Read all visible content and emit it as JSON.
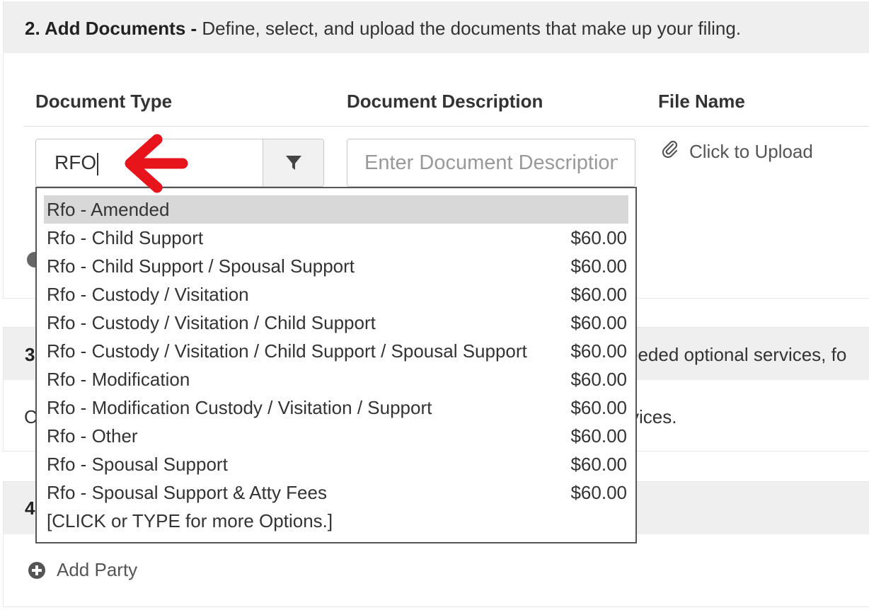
{
  "section2": {
    "number_title": "2. Add Documents -",
    "description": " Define, select, and upload the documents that make up your filing.",
    "columns": {
      "document_type": "Document Type",
      "document_description": "Document Description",
      "file_name": "File Name"
    },
    "type_input_value": "RFO",
    "description_placeholder": "Enter Document Description",
    "upload_label": "Click to Upload",
    "dropdown": {
      "items": [
        {
          "label": "Rfo - Amended",
          "price": "",
          "selected": true
        },
        {
          "label": "Rfo - Child Support",
          "price": "$60.00"
        },
        {
          "label": "Rfo - Child Support / Spousal Support",
          "price": "$60.00"
        },
        {
          "label": "Rfo - Custody / Visitation",
          "price": "$60.00"
        },
        {
          "label": "Rfo - Custody / Visitation / Child Support",
          "price": "$60.00"
        },
        {
          "label": "Rfo - Custody / Visitation / Child Support / Spousal Support",
          "price": "$60.00"
        },
        {
          "label": "Rfo - Modification",
          "price": "$60.00"
        },
        {
          "label": "Rfo - Modification Custody / Visitation / Support",
          "price": "$60.00"
        },
        {
          "label": "Rfo - Other",
          "price": "$60.00"
        },
        {
          "label": "Rfo - Spousal Support",
          "price": "$60.00"
        },
        {
          "label": "Rfo - Spousal Support & Atty Fees",
          "price": "$60.00"
        },
        {
          "label": "[CLICK or TYPE for more Options.]",
          "price": ""
        }
      ]
    }
  },
  "section3": {
    "head_left": "3",
    "head_right": "eeded optional services, fo",
    "body_left": "C",
    "body_right": "vices."
  },
  "section4": {
    "head_left": "4",
    "add_party_label": "Add Party"
  },
  "colors": {
    "arrow": "#e8141c",
    "header_bg": "#efefef",
    "selected_item_bg": "#d8d8d8"
  }
}
